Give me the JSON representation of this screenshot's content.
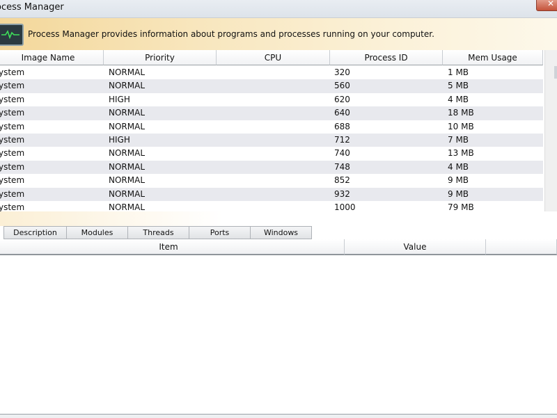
{
  "window": {
    "title": "ocess Manager",
    "close_icon": "close-icon"
  },
  "banner": {
    "icon": "activity-monitor-icon",
    "text": "Process Manager provides information about programs and processes running on your computer."
  },
  "process_table": {
    "columns": [
      "Image Name",
      "Priority",
      "CPU",
      "Process ID",
      "Mem Usage"
    ],
    "rows": [
      [
        "ystem",
        "NORMAL",
        "",
        "320",
        "1 MB"
      ],
      [
        "ystem",
        "NORMAL",
        "",
        "560",
        "5 MB"
      ],
      [
        "ystem",
        "HIGH",
        "",
        "620",
        "4 MB"
      ],
      [
        "ystem",
        "NORMAL",
        "",
        "640",
        "18 MB"
      ],
      [
        "ystem",
        "NORMAL",
        "",
        "688",
        "10 MB"
      ],
      [
        "ystem",
        "HIGH",
        "",
        "712",
        "7 MB"
      ],
      [
        "ystem",
        "NORMAL",
        "",
        "740",
        "13 MB"
      ],
      [
        "ystem",
        "NORMAL",
        "",
        "748",
        "4 MB"
      ],
      [
        "ystem",
        "NORMAL",
        "",
        "852",
        "9 MB"
      ],
      [
        "ystem",
        "NORMAL",
        "",
        "932",
        "9 MB"
      ],
      [
        "ystem",
        "NORMAL",
        "",
        "1000",
        "79 MB"
      ]
    ]
  },
  "detail_tabs": [
    "Description",
    "Modules",
    "Threads",
    "Ports",
    "Windows"
  ],
  "detail_table": {
    "columns": [
      "Item",
      "Value"
    ]
  }
}
